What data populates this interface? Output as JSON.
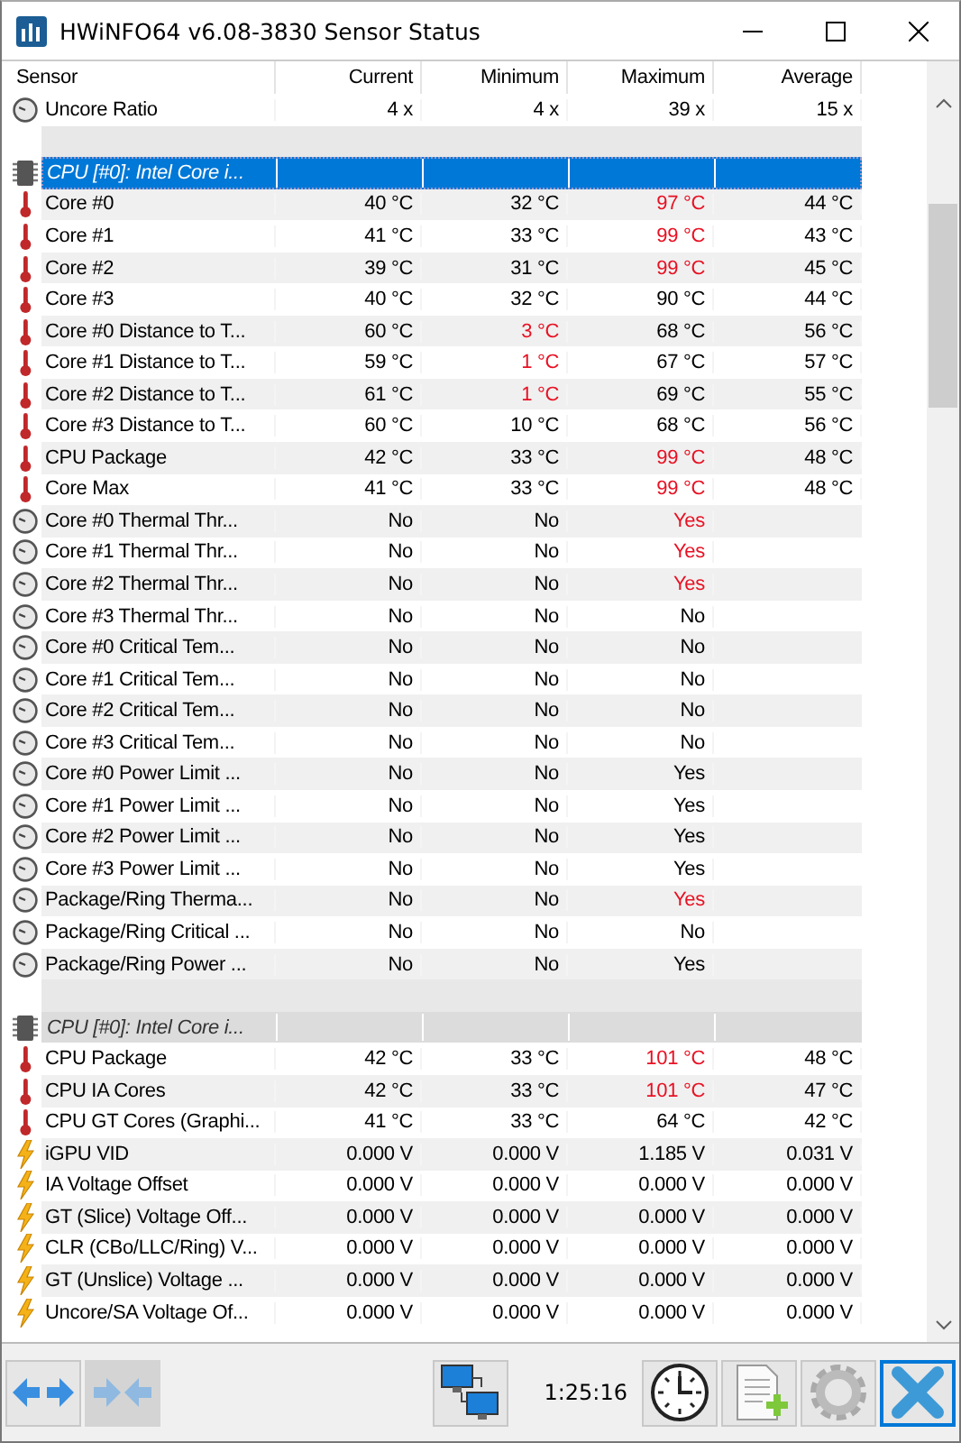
{
  "window": {
    "title": "HWiNFO64 v6.08-3830 Sensor Status"
  },
  "table": {
    "columns": [
      "Sensor",
      "Current",
      "Minimum",
      "Maximum",
      "Average"
    ],
    "rows": [
      {
        "kind": "clock",
        "name": "Uncore Ratio",
        "cells": [
          {
            "text": "4 x",
            "alert": false
          },
          {
            "text": "4 x",
            "alert": false
          },
          {
            "text": "39 x",
            "alert": false
          },
          {
            "text": "15 x",
            "alert": false
          }
        ]
      },
      {
        "kind": "blank"
      },
      {
        "kind": "group",
        "name": "CPU [#0]: Intel Core i...",
        "selected": true
      },
      {
        "kind": "temp",
        "name": "Core #0",
        "cells": [
          {
            "text": "40 °C",
            "alert": false
          },
          {
            "text": "32 °C",
            "alert": false
          },
          {
            "text": "97 °C",
            "alert": true
          },
          {
            "text": "44 °C",
            "alert": false
          }
        ]
      },
      {
        "kind": "temp",
        "name": "Core #1",
        "cells": [
          {
            "text": "41 °C",
            "alert": false
          },
          {
            "text": "33 °C",
            "alert": false
          },
          {
            "text": "99 °C",
            "alert": true
          },
          {
            "text": "43 °C",
            "alert": false
          }
        ]
      },
      {
        "kind": "temp",
        "name": "Core #2",
        "cells": [
          {
            "text": "39 °C",
            "alert": false
          },
          {
            "text": "31 °C",
            "alert": false
          },
          {
            "text": "99 °C",
            "alert": true
          },
          {
            "text": "45 °C",
            "alert": false
          }
        ]
      },
      {
        "kind": "temp",
        "name": "Core #3",
        "cells": [
          {
            "text": "40 °C",
            "alert": false
          },
          {
            "text": "32 °C",
            "alert": false
          },
          {
            "text": "90 °C",
            "alert": false
          },
          {
            "text": "44 °C",
            "alert": false
          }
        ]
      },
      {
        "kind": "temp",
        "name": "Core #0 Distance to T...",
        "cells": [
          {
            "text": "60 °C",
            "alert": false
          },
          {
            "text": "3 °C",
            "alert": true
          },
          {
            "text": "68 °C",
            "alert": false
          },
          {
            "text": "56 °C",
            "alert": false
          }
        ]
      },
      {
        "kind": "temp",
        "name": "Core #1 Distance to T...",
        "cells": [
          {
            "text": "59 °C",
            "alert": false
          },
          {
            "text": "1 °C",
            "alert": true
          },
          {
            "text": "67 °C",
            "alert": false
          },
          {
            "text": "57 °C",
            "alert": false
          }
        ]
      },
      {
        "kind": "temp",
        "name": "Core #2 Distance to T...",
        "cells": [
          {
            "text": "61 °C",
            "alert": false
          },
          {
            "text": "1 °C",
            "alert": true
          },
          {
            "text": "69 °C",
            "alert": false
          },
          {
            "text": "55 °C",
            "alert": false
          }
        ]
      },
      {
        "kind": "temp",
        "name": "Core #3 Distance to T...",
        "cells": [
          {
            "text": "60 °C",
            "alert": false
          },
          {
            "text": "10 °C",
            "alert": false
          },
          {
            "text": "68 °C",
            "alert": false
          },
          {
            "text": "56 °C",
            "alert": false
          }
        ]
      },
      {
        "kind": "temp",
        "name": "CPU Package",
        "cells": [
          {
            "text": "42 °C",
            "alert": false
          },
          {
            "text": "33 °C",
            "alert": false
          },
          {
            "text": "99 °C",
            "alert": true
          },
          {
            "text": "48 °C",
            "alert": false
          }
        ]
      },
      {
        "kind": "temp",
        "name": "Core Max",
        "cells": [
          {
            "text": "41 °C",
            "alert": false
          },
          {
            "text": "33 °C",
            "alert": false
          },
          {
            "text": "99 °C",
            "alert": true
          },
          {
            "text": "48 °C",
            "alert": false
          }
        ]
      },
      {
        "kind": "clock",
        "name": "Core #0 Thermal Thr...",
        "cells": [
          {
            "text": "No",
            "alert": false
          },
          {
            "text": "No",
            "alert": false
          },
          {
            "text": "Yes",
            "alert": true
          }
        ]
      },
      {
        "kind": "clock",
        "name": "Core #1 Thermal Thr...",
        "cells": [
          {
            "text": "No",
            "alert": false
          },
          {
            "text": "No",
            "alert": false
          },
          {
            "text": "Yes",
            "alert": true
          }
        ]
      },
      {
        "kind": "clock",
        "name": "Core #2 Thermal Thr...",
        "cells": [
          {
            "text": "No",
            "alert": false
          },
          {
            "text": "No",
            "alert": false
          },
          {
            "text": "Yes",
            "alert": true
          }
        ]
      },
      {
        "kind": "clock",
        "name": "Core #3 Thermal Thr...",
        "cells": [
          {
            "text": "No",
            "alert": false
          },
          {
            "text": "No",
            "alert": false
          },
          {
            "text": "No",
            "alert": false
          }
        ]
      },
      {
        "kind": "clock",
        "name": "Core #0 Critical Tem...",
        "cells": [
          {
            "text": "No",
            "alert": false
          },
          {
            "text": "No",
            "alert": false
          },
          {
            "text": "No",
            "alert": false
          }
        ]
      },
      {
        "kind": "clock",
        "name": "Core #1 Critical Tem...",
        "cells": [
          {
            "text": "No",
            "alert": false
          },
          {
            "text": "No",
            "alert": false
          },
          {
            "text": "No",
            "alert": false
          }
        ]
      },
      {
        "kind": "clock",
        "name": "Core #2 Critical Tem...",
        "cells": [
          {
            "text": "No",
            "alert": false
          },
          {
            "text": "No",
            "alert": false
          },
          {
            "text": "No",
            "alert": false
          }
        ]
      },
      {
        "kind": "clock",
        "name": "Core #3 Critical Tem...",
        "cells": [
          {
            "text": "No",
            "alert": false
          },
          {
            "text": "No",
            "alert": false
          },
          {
            "text": "No",
            "alert": false
          }
        ]
      },
      {
        "kind": "clock",
        "name": "Core #0 Power Limit ...",
        "cells": [
          {
            "text": "No",
            "alert": false
          },
          {
            "text": "No",
            "alert": false
          },
          {
            "text": "Yes",
            "alert": false
          }
        ]
      },
      {
        "kind": "clock",
        "name": "Core #1 Power Limit ...",
        "cells": [
          {
            "text": "No",
            "alert": false
          },
          {
            "text": "No",
            "alert": false
          },
          {
            "text": "Yes",
            "alert": false
          }
        ]
      },
      {
        "kind": "clock",
        "name": "Core #2 Power Limit ...",
        "cells": [
          {
            "text": "No",
            "alert": false
          },
          {
            "text": "No",
            "alert": false
          },
          {
            "text": "Yes",
            "alert": false
          }
        ]
      },
      {
        "kind": "clock",
        "name": "Core #3 Power Limit ...",
        "cells": [
          {
            "text": "No",
            "alert": false
          },
          {
            "text": "No",
            "alert": false
          },
          {
            "text": "Yes",
            "alert": false
          }
        ]
      },
      {
        "kind": "clock",
        "name": "Package/Ring Therma...",
        "cells": [
          {
            "text": "No",
            "alert": false
          },
          {
            "text": "No",
            "alert": false
          },
          {
            "text": "Yes",
            "alert": true
          }
        ]
      },
      {
        "kind": "clock",
        "name": "Package/Ring Critical ...",
        "cells": [
          {
            "text": "No",
            "alert": false
          },
          {
            "text": "No",
            "alert": false
          },
          {
            "text": "No",
            "alert": false
          }
        ]
      },
      {
        "kind": "clock",
        "name": "Package/Ring Power ...",
        "cells": [
          {
            "text": "No",
            "alert": false
          },
          {
            "text": "No",
            "alert": false
          },
          {
            "text": "Yes",
            "alert": false
          }
        ]
      },
      {
        "kind": "blank"
      },
      {
        "kind": "group",
        "name": "CPU [#0]: Intel Core i...",
        "selected": false
      },
      {
        "kind": "temp",
        "name": "CPU Package",
        "cells": [
          {
            "text": "42 °C",
            "alert": false
          },
          {
            "text": "33 °C",
            "alert": false
          },
          {
            "text": "101 °C",
            "alert": true
          },
          {
            "text": "48 °C",
            "alert": false
          }
        ]
      },
      {
        "kind": "temp",
        "name": "CPU IA Cores",
        "cells": [
          {
            "text": "42 °C",
            "alert": false
          },
          {
            "text": "33 °C",
            "alert": false
          },
          {
            "text": "101 °C",
            "alert": true
          },
          {
            "text": "47 °C",
            "alert": false
          }
        ]
      },
      {
        "kind": "temp",
        "name": "CPU GT Cores (Graphi...",
        "cells": [
          {
            "text": "41 °C",
            "alert": false
          },
          {
            "text": "33 °C",
            "alert": false
          },
          {
            "text": "64 °C",
            "alert": false
          },
          {
            "text": "42 °C",
            "alert": false
          }
        ]
      },
      {
        "kind": "volt",
        "name": "iGPU VID",
        "cells": [
          {
            "text": "0.000 V",
            "alert": false
          },
          {
            "text": "0.000 V",
            "alert": false
          },
          {
            "text": "1.185 V",
            "alert": false
          },
          {
            "text": "0.031 V",
            "alert": false
          }
        ]
      },
      {
        "kind": "volt",
        "name": "IA Voltage Offset",
        "cells": [
          {
            "text": "0.000 V",
            "alert": false
          },
          {
            "text": "0.000 V",
            "alert": false
          },
          {
            "text": "0.000 V",
            "alert": false
          },
          {
            "text": "0.000 V",
            "alert": false
          }
        ]
      },
      {
        "kind": "volt",
        "name": "GT (Slice) Voltage Off...",
        "cells": [
          {
            "text": "0.000 V",
            "alert": false
          },
          {
            "text": "0.000 V",
            "alert": false
          },
          {
            "text": "0.000 V",
            "alert": false
          },
          {
            "text": "0.000 V",
            "alert": false
          }
        ]
      },
      {
        "kind": "volt",
        "name": "CLR (CBo/LLC/Ring) V...",
        "cells": [
          {
            "text": "0.000 V",
            "alert": false
          },
          {
            "text": "0.000 V",
            "alert": false
          },
          {
            "text": "0.000 V",
            "alert": false
          },
          {
            "text": "0.000 V",
            "alert": false
          }
        ]
      },
      {
        "kind": "volt",
        "name": "GT (Unslice) Voltage ...",
        "cells": [
          {
            "text": "0.000 V",
            "alert": false
          },
          {
            "text": "0.000 V",
            "alert": false
          },
          {
            "text": "0.000 V",
            "alert": false
          },
          {
            "text": "0.000 V",
            "alert": false
          }
        ]
      },
      {
        "kind": "volt",
        "name": "Uncore/SA Voltage Of...",
        "cells": [
          {
            "text": "0.000 V",
            "alert": false
          },
          {
            "text": "0.000 V",
            "alert": false
          },
          {
            "text": "0.000 V",
            "alert": false
          },
          {
            "text": "0.000 V",
            "alert": false
          }
        ]
      }
    ]
  },
  "toolbar": {
    "buttons": [
      {
        "kind": "expand",
        "disabled": false,
        "focused": false
      },
      {
        "kind": "collapse",
        "disabled": true,
        "focused": false
      },
      {
        "kind": "network",
        "disabled": false,
        "focused": false
      },
      {
        "kind": "timer",
        "disabled": false,
        "focused": false
      },
      {
        "kind": "report",
        "disabled": false,
        "focused": false
      },
      {
        "kind": "settings",
        "disabled": false,
        "focused": false
      },
      {
        "kind": "close",
        "disabled": false,
        "focused": true
      }
    ],
    "elapsed": "1:25:16"
  }
}
